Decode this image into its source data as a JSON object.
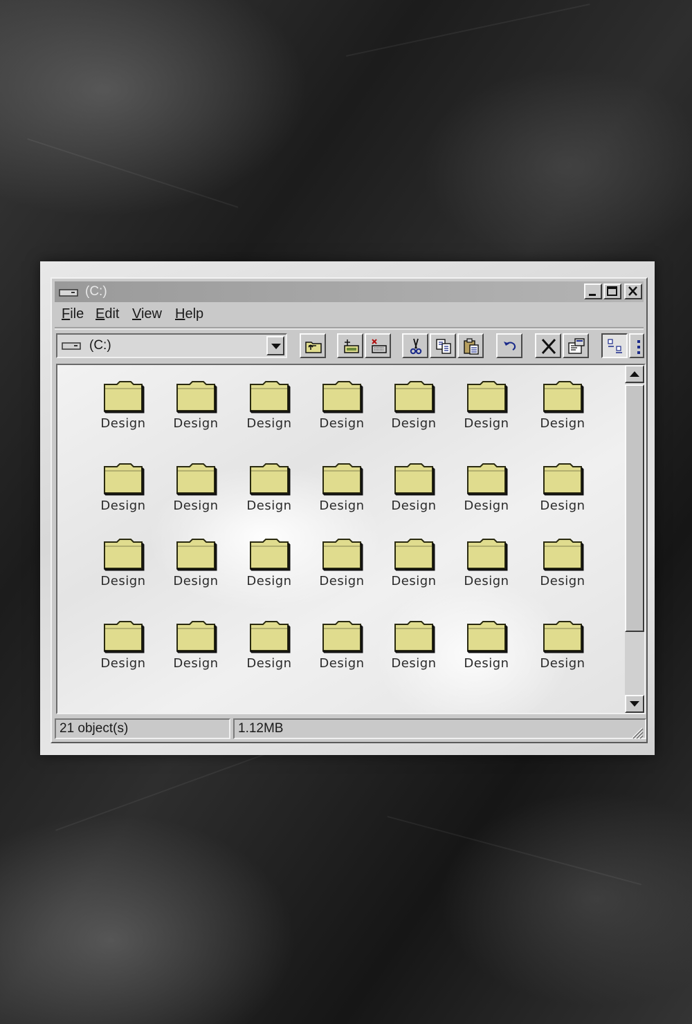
{
  "window": {
    "title": "(C:)",
    "controls": [
      "minimize",
      "maximize",
      "close"
    ]
  },
  "menu": {
    "file": "File",
    "edit": "Edit",
    "view": "View",
    "help": "Help"
  },
  "toolbar": {
    "address_value": "(C:)",
    "buttons": [
      "up-folder",
      "map-drive",
      "disconnect-drive",
      "cut",
      "copy",
      "paste",
      "undo",
      "delete",
      "properties",
      "large-icons",
      "small-icons"
    ]
  },
  "folders": [
    "Design",
    "Design",
    "Design",
    "Design",
    "Design",
    "Design",
    "Design",
    "Design",
    "Design",
    "Design",
    "Design",
    "Design",
    "Design",
    "Design",
    "Design",
    "Design",
    "Design",
    "Design",
    "Design",
    "Design",
    "Design",
    "Design",
    "Design",
    "Design",
    "Design",
    "Design",
    "Design",
    "Design"
  ],
  "status": {
    "objects": "21 object(s)",
    "size": "1.12MB"
  },
  "colors": {
    "folder_fill": "#e0dc8e",
    "folder_dark": "#2a2a10",
    "titlebar": "#a8a8a8",
    "chrome": "#c9c9c9"
  }
}
